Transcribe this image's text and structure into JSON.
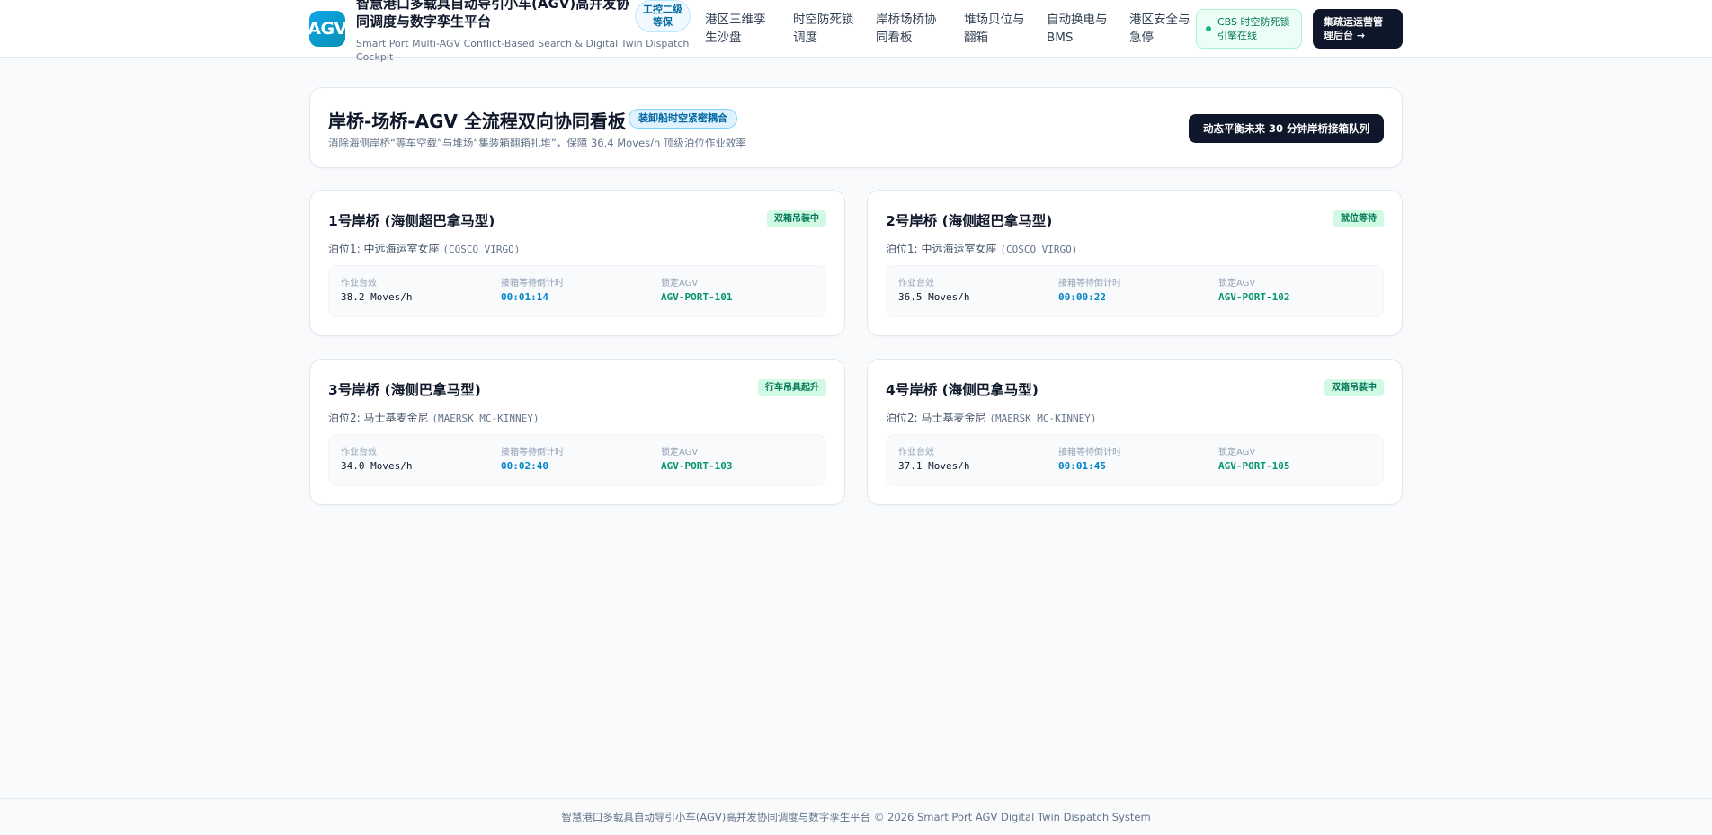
{
  "header": {
    "logo_text": "AGV",
    "title": "智慧港口多载具自动导引小车(AGV)高并发协同调度与数字孪生平台",
    "subtitle": "Smart Port Multi-AGV Conflict-Based Search & Digital Twin Dispatch Cockpit",
    "level_badge": "工控二级等保",
    "nav": [
      {
        "label": "港区三维孪生沙盘"
      },
      {
        "label": "时空防死锁调度"
      },
      {
        "label": "岸桥场桥协同看板"
      },
      {
        "label": "堆场贝位与翻箱"
      },
      {
        "label": "自动换电与BMS"
      },
      {
        "label": "港区安全与急停"
      }
    ],
    "status": "CBS 时空防死锁引擎在线",
    "admin_button": "集疏运运营管理后台 →"
  },
  "banner": {
    "title": "岸桥-场桥-AGV 全流程双向协同看板",
    "tag": "装卸船时空紧密耦合",
    "subtitle": "消除海侧岸桥“等车空载”与堆场“集装箱翻箱扎堆”，保障 36.4 Moves/h 顶级泊位作业效率",
    "button": "动态平衡未来 30 分钟岸桥接箱队列"
  },
  "cranes": [
    {
      "title": "1号岸桥 (海侧超巴拿马型)",
      "status": "双箱吊装中",
      "berth_cn": "泊位1: 中远海运室女座",
      "berth_en": "(COSCO VIRGO)",
      "rate_label": "作业台效",
      "rate": "38.2 Moves/h",
      "timer_label": "接箱等待倒计时",
      "timer": "00:01:14",
      "agv_label": "锁定AGV",
      "agv": "AGV-PORT-101"
    },
    {
      "title": "2号岸桥 (海侧超巴拿马型)",
      "status": "就位等待",
      "berth_cn": "泊位1: 中远海运室女座",
      "berth_en": "(COSCO VIRGO)",
      "rate_label": "作业台效",
      "rate": "36.5 Moves/h",
      "timer_label": "接箱等待倒计时",
      "timer": "00:00:22",
      "agv_label": "锁定AGV",
      "agv": "AGV-PORT-102"
    },
    {
      "title": "3号岸桥 (海侧巴拿马型)",
      "status": "行车吊具起升",
      "berth_cn": "泊位2: 马士基麦金尼",
      "berth_en": "(MAERSK MC-KINNEY)",
      "rate_label": "作业台效",
      "rate": "34.0 Moves/h",
      "timer_label": "接箱等待倒计时",
      "timer": "00:02:40",
      "agv_label": "锁定AGV",
      "agv": "AGV-PORT-103"
    },
    {
      "title": "4号岸桥 (海侧巴拿马型)",
      "status": "双箱吊装中",
      "berth_cn": "泊位2: 马士基麦金尼",
      "berth_en": "(MAERSK MC-KINNEY)",
      "rate_label": "作业台效",
      "rate": "37.1 Moves/h",
      "timer_label": "接箱等待倒计时",
      "timer": "00:01:45",
      "agv_label": "锁定AGV",
      "agv": "AGV-PORT-105"
    }
  ],
  "footer": "智慧港口多载具自动导引小车(AGV)高并发协同调度与数字孪生平台 © 2026 Smart Port AGV Digital Twin Dispatch System"
}
